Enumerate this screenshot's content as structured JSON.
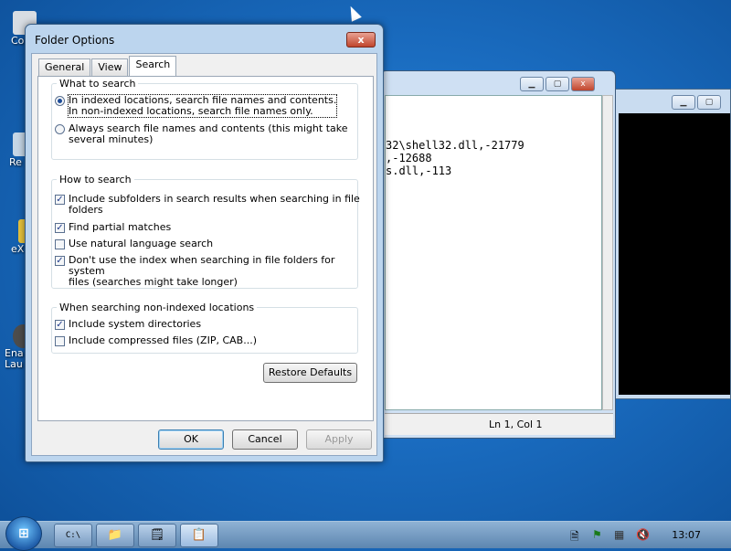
{
  "desktop": {
    "icons": [
      {
        "label": "Co",
        "color": "#d8dde3"
      },
      {
        "label": "Re",
        "color": "#c5d6e6"
      },
      {
        "label": "eX",
        "color": "#e8c33c"
      },
      {
        "label": "Ena\nLau",
        "color": "#4d4d4d"
      }
    ]
  },
  "bg_window_editor": {
    "lines": [
      "32\\shell32.dll,-21779",
      ",-12688",
      "s.dll,-113"
    ],
    "status": "Ln 1, Col 1"
  },
  "dialog": {
    "title": "Folder Options",
    "close_label": "x",
    "tabs": [
      "General",
      "View",
      "Search"
    ],
    "active_tab": "Search",
    "groups": {
      "what_to_search": {
        "legend": "What to search",
        "options": [
          {
            "line1": "In indexed locations, search file names and contents.",
            "line2": "In non-indexed locations, search file names only.",
            "selected": true
          },
          {
            "line1": "Always search file names and contents (this might take",
            "line2": "several minutes)",
            "selected": false
          }
        ]
      },
      "how_to_search": {
        "legend": "How to search",
        "options": [
          {
            "line1": "Include subfolders in search results when searching in file",
            "line2": "folders",
            "checked": true
          },
          {
            "line1": "Find partial matches",
            "line2": "",
            "checked": true
          },
          {
            "line1": "Use natural language search",
            "line2": "",
            "checked": false
          },
          {
            "line1": "Don't use the index when searching in file folders for system",
            "line2": "files (searches might take longer)",
            "checked": true
          }
        ]
      },
      "non_indexed": {
        "legend": "When searching non-indexed locations",
        "options": [
          {
            "line1": "Include system directories",
            "line2": "",
            "checked": true
          },
          {
            "line1": "Include compressed files (ZIP, CAB...)",
            "line2": "",
            "checked": false
          }
        ]
      }
    },
    "restore_label": "Restore Defaults",
    "ok_label": "OK",
    "cancel_label": "Cancel",
    "apply_label": "Apply"
  },
  "taskbar": {
    "start_label": "⊞",
    "buttons": [
      {
        "name": "cmd",
        "glyph": "C:\\"
      },
      {
        "name": "explorer",
        "glyph": "📁"
      },
      {
        "name": "notepad",
        "glyph": "🗒"
      },
      {
        "name": "active-app",
        "glyph": "📋"
      }
    ],
    "clock": "13:07"
  }
}
